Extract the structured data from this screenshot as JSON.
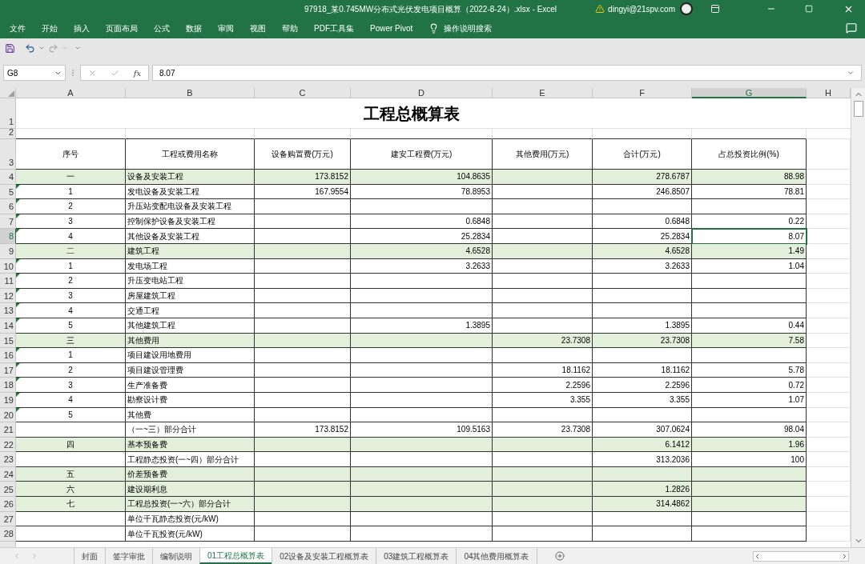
{
  "window": {
    "title": "97918_某0.745MW分布式光伏发电项目概算（2022-8-24）.xlsx  -  Excel",
    "account": "dingyi@21spv.com"
  },
  "menu": [
    "文件",
    "开始",
    "插入",
    "页面布局",
    "公式",
    "数据",
    "审阅",
    "视图",
    "帮助",
    "PDF工具集",
    "Power Pivot"
  ],
  "tell_me": "操作说明搜索",
  "formula_bar": {
    "name_box": "G8",
    "fx": "fx",
    "value": "8.07"
  },
  "sheet": {
    "columns": [
      {
        "label": "A",
        "selected": false
      },
      {
        "label": "B",
        "selected": false
      },
      {
        "label": "C",
        "selected": false
      },
      {
        "label": "D",
        "selected": false
      },
      {
        "label": "E",
        "selected": false
      },
      {
        "label": "F",
        "selected": false
      },
      {
        "label": "G",
        "selected": true
      },
      {
        "label": "H",
        "selected": false
      }
    ],
    "title_row": {
      "row": "1",
      "text": "工程总概算表"
    },
    "spacer_row": {
      "row": "2"
    },
    "header_row": {
      "row": "3",
      "cells": [
        "序号",
        "工程或费用名称",
        "设备购置费(万元)",
        "建安工程费(万元)",
        "其他费用(万元)",
        "合计(万元)",
        "占总投资比例(%)"
      ]
    },
    "rows": [
      {
        "row": "4",
        "highlighted": true,
        "flagged": false,
        "selected": false,
        "cells": {
          "a": "一",
          "b": "设备及安装工程",
          "c": "173.8152",
          "d": "104.8635",
          "f": "278.6787",
          "g": "88.98"
        }
      },
      {
        "row": "5",
        "highlighted": false,
        "flagged": true,
        "selected": false,
        "cells": {
          "a": "1",
          "b": "发电设备及安装工程",
          "c": "167.9554",
          "d": "78.8953",
          "f": "246.8507",
          "g": "78.81"
        }
      },
      {
        "row": "6",
        "highlighted": false,
        "flagged": true,
        "selected": false,
        "cells": {
          "a": "2",
          "b": "升压站变配电设备及安装工程"
        }
      },
      {
        "row": "7",
        "highlighted": false,
        "flagged": true,
        "selected": false,
        "cells": {
          "a": "3",
          "b": "控制保护设备及安装工程",
          "d": "0.6848",
          "f": "0.6848",
          "g": "0.22"
        }
      },
      {
        "row": "8",
        "highlighted": false,
        "flagged": true,
        "selected": true,
        "cells": {
          "a": "4",
          "b": "其他设备及安装工程",
          "d": "25.2834",
          "f": "25.2834",
          "g": "8.07"
        }
      },
      {
        "row": "9",
        "highlighted": true,
        "flagged": false,
        "selected": false,
        "cells": {
          "a": "二",
          "b": "建筑工程",
          "d": "4.6528",
          "f": "4.6528",
          "g": "1.49"
        }
      },
      {
        "row": "10",
        "highlighted": false,
        "flagged": true,
        "selected": false,
        "cells": {
          "a": "1",
          "b": "发电场工程",
          "d": "3.2633",
          "f": "3.2633",
          "g": "1.04"
        }
      },
      {
        "row": "11",
        "highlighted": false,
        "flagged": true,
        "selected": false,
        "cells": {
          "a": "2",
          "b": "升压变电站工程"
        }
      },
      {
        "row": "12",
        "highlighted": false,
        "flagged": true,
        "selected": false,
        "cells": {
          "a": "3",
          "b": "房屋建筑工程"
        }
      },
      {
        "row": "13",
        "highlighted": false,
        "flagged": true,
        "selected": false,
        "cells": {
          "a": "4",
          "b": "交通工程"
        }
      },
      {
        "row": "14",
        "highlighted": false,
        "flagged": true,
        "selected": false,
        "cells": {
          "a": "5",
          "b": "其他建筑工程",
          "d": "1.3895",
          "f": "1.3895",
          "g": "0.44"
        }
      },
      {
        "row": "15",
        "highlighted": true,
        "flagged": false,
        "selected": false,
        "cells": {
          "a": "三",
          "b": "其他费用",
          "e": "23.7308",
          "f": "23.7308",
          "g": "7.58"
        }
      },
      {
        "row": "16",
        "highlighted": false,
        "flagged": true,
        "selected": false,
        "cells": {
          "a": "1",
          "b": "项目建设用地费用"
        }
      },
      {
        "row": "17",
        "highlighted": false,
        "flagged": true,
        "selected": false,
        "cells": {
          "a": "2",
          "b": "项目建设管理费",
          "e": "18.1162",
          "f": "18.1162",
          "g": "5.78"
        }
      },
      {
        "row": "18",
        "highlighted": false,
        "flagged": true,
        "selected": false,
        "cells": {
          "a": "3",
          "b": "生产准备费",
          "e": "2.2596",
          "f": "2.2596",
          "g": "0.72"
        }
      },
      {
        "row": "19",
        "highlighted": false,
        "flagged": true,
        "selected": false,
        "cells": {
          "a": "4",
          "b": "勘察设计费",
          "e": "3.355",
          "f": "3.355",
          "g": "1.07"
        }
      },
      {
        "row": "20",
        "highlighted": false,
        "flagged": true,
        "selected": false,
        "cells": {
          "a": "5",
          "b": "其他费"
        }
      },
      {
        "row": "21",
        "highlighted": false,
        "flagged": false,
        "selected": false,
        "cells": {
          "b": "（一~三）部分合计",
          "c": "173.8152",
          "d": "109.5163",
          "e": "23.7308",
          "f": "307.0624",
          "g": "98.04"
        }
      },
      {
        "row": "22",
        "highlighted": true,
        "flagged": false,
        "selected": false,
        "cells": {
          "a": "四",
          "b": "基本预备费",
          "f": "6.1412",
          "g": "1.96"
        }
      },
      {
        "row": "23",
        "highlighted": false,
        "flagged": false,
        "selected": false,
        "cells": {
          "b": "工程静态投资(一~四）部分合计",
          "f": "313.2036",
          "g": "100"
        }
      },
      {
        "row": "24",
        "highlighted": true,
        "flagged": false,
        "selected": false,
        "cells": {
          "a": "五",
          "b": "价差预备费"
        }
      },
      {
        "row": "25",
        "highlighted": true,
        "flagged": false,
        "selected": false,
        "cells": {
          "a": "六",
          "b": "建设期利息",
          "f": "1.2826"
        }
      },
      {
        "row": "26",
        "highlighted": true,
        "flagged": false,
        "selected": false,
        "cells": {
          "a": "七",
          "b": "工程总投资(一~六）部分合计",
          "f": "314.4862"
        }
      },
      {
        "row": "27",
        "highlighted": false,
        "flagged": false,
        "selected": false,
        "cells": {
          "b": "单位千瓦静态投资(元/kW)"
        }
      },
      {
        "row": "28",
        "highlighted": false,
        "flagged": false,
        "selected": false,
        "cells": {
          "b": "单位千瓦投资(元/kW)"
        }
      }
    ]
  },
  "sheet_tabs": [
    {
      "label": "封面",
      "selected": false
    },
    {
      "label": "签字审批",
      "selected": false
    },
    {
      "label": "编制说明",
      "selected": false
    },
    {
      "label": "01工程总概算表",
      "selected": true
    },
    {
      "label": "02设备及安装工程概算表",
      "selected": false
    },
    {
      "label": "03建筑工程概算表",
      "selected": false
    },
    {
      "label": "04其他费用概算表",
      "selected": false
    }
  ]
}
